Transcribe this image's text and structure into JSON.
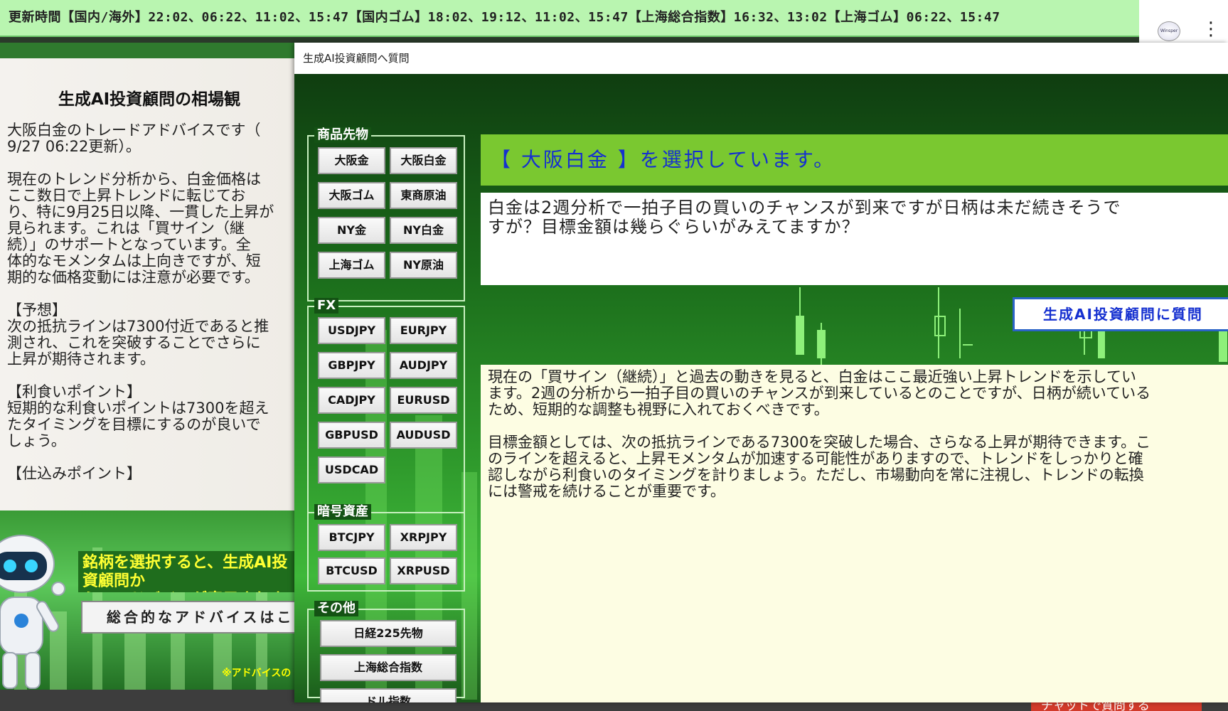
{
  "ticker": {
    "text": "更新時間【国内/海外】22:02、06:22、11:02、15:47【国内ゴム】18:02、19:12、11:02、15:47【上海総合指数】16:32、13:02【上海ゴム】06:22、15:47"
  },
  "top_right": {
    "logo_text": "Winsper",
    "menu_icon": "more-vertical-icon"
  },
  "back_panel": {
    "title": "生成AI投資顧問の相場観",
    "text": "大阪白金のトレードアドバイスです（\n9/27 06:22更新）。\n\n現在のトレンド分析から、白金価格は\nここ数日で上昇トレンドに転じてお\nり、特に9月25日以降、一貫した上昇が\n見られます。これは「買サイン（継\n続）」のサポートとなっています。全\n体的なモメンタムは上向きですが、短\n期的な価格変動には注意が必要です。\n\n【予想】\n次の抵抗ラインは7300付近であると推\n測され、これを突破することでさらに\n上昇が期待されます。\n\n【利食いポイント】\n短期的な利食いポイントは7300を超え\nたタイミングを目標にするのが良いで\nしょう。\n\n【仕込みポイント】",
    "banner": "銘柄を選択すると、生成AI投資顧問か\nらのアドバイスが表示されます。",
    "overall_button": "総合的なアドバイスはこちら",
    "note": "※アドバイスの"
  },
  "chat_button": "チャットで質問する",
  "dialog": {
    "title": "生成AI投資顧問へ質問",
    "groups": {
      "futures": {
        "label": "商品先物",
        "buttons": [
          "大阪金",
          "大阪白金",
          "大阪ゴム",
          "東商原油",
          "NY金",
          "NY白金",
          "上海ゴム",
          "NY原油"
        ]
      },
      "fx": {
        "label": "FX",
        "buttons": [
          "USDJPY",
          "EURJPY",
          "GBPJPY",
          "AUDJPY",
          "CADJPY",
          "EURUSD",
          "GBPUSD",
          "AUDUSD",
          "USDCAD"
        ]
      },
      "crypto": {
        "label": "暗号資産",
        "buttons": [
          "BTCJPY",
          "XRPJPY",
          "BTCUSD",
          "XRPUSD"
        ]
      },
      "other": {
        "label": "その他",
        "buttons": [
          "日経225先物",
          "上海総合指数",
          "ドル指数"
        ]
      }
    },
    "selected_header": "【 大阪白金 】を選択しています。",
    "question": "白金は2週分析で一拍子目の買いのチャンスが到来ですが日柄は未だ続きそうで\nすが？目標金額は幾らぐらいがみえてますか？",
    "ask_button": "生成AI投資顧問に質問",
    "answer": "現在の「買サイン（継続）」と過去の動きを見ると、白金はここ最近強い上昇トレンドを示してい\nます。2週の分析から一拍子目の買いのチャンスが到来しているとのことですが、日柄が続いている\nため、短期的な調整も視野に入れておくべきです。\n\n目標金額としては、次の抵抗ラインである7300を突破した場合、さらなる上昇が期待できます。こ\nのラインを超えると、上昇モメンタムが加速する可能性がありますので、トレンドをしっかりと確\n認しながら利食いのタイミングを計りましょう。ただし、市場動向を常に注視し、トレンドの転換\nには警戒を続けることが重要です。"
  }
}
